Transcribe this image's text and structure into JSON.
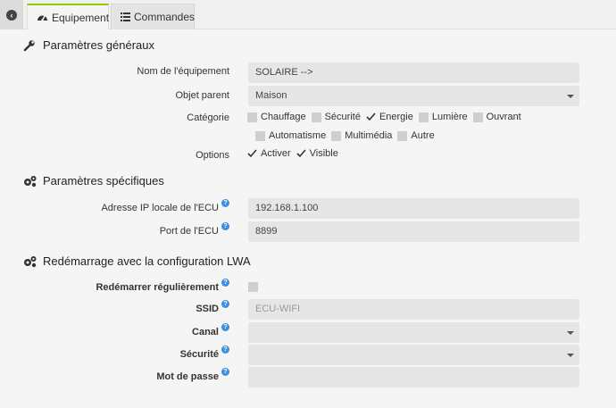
{
  "tabs": {
    "equipement": "Equipement",
    "commandes": "Commandes"
  },
  "general": {
    "title": "Paramètres généraux",
    "name_label": "Nom de l'équipement",
    "name_value": "SOLAIRE -->",
    "parent_label": "Objet parent",
    "parent_value": "Maison",
    "category_label": "Catégorie",
    "categories": [
      {
        "label": "Chauffage",
        "checked": false
      },
      {
        "label": "Sécurité",
        "checked": false
      },
      {
        "label": "Energie",
        "checked": true
      },
      {
        "label": "Lumière",
        "checked": false
      },
      {
        "label": "Ouvrant",
        "checked": false
      },
      {
        "label": "Automatisme",
        "checked": false
      },
      {
        "label": "Multimédia",
        "checked": false
      },
      {
        "label": "Autre",
        "checked": false
      }
    ],
    "options_label": "Options",
    "options": [
      {
        "label": "Activer",
        "checked": true
      },
      {
        "label": "Visible",
        "checked": true
      }
    ]
  },
  "specific": {
    "title": "Paramètres spécifiques",
    "ip_label": "Adresse IP locale de l'ECU",
    "ip_value": "192.168.1.100",
    "port_label": "Port de l'ECU",
    "port_value": "8899"
  },
  "reboot": {
    "title": "Redémarrage avec la configuration LWA",
    "restart_label": "Redémarrer régulièrement",
    "restart_checked": false,
    "ssid_label": "SSID",
    "ssid_placeholder": "ECU-WIFI",
    "canal_label": "Canal",
    "canal_value": "",
    "security_label": "Sécurité",
    "security_value": "",
    "password_label": "Mot de passe",
    "password_value": ""
  },
  "icons": {
    "back": "back-circle-icon",
    "equipement": "tachometer-icon",
    "commandes": "list-icon",
    "general": "wrench-icon",
    "specific": "cogs-icon",
    "reboot": "cogs-icon",
    "help": "question-circle-icon",
    "checkmark": "checkmark-icon"
  },
  "colors": {
    "accent": "#94ca02",
    "help": "#3d8fe0",
    "field_bg": "#e6e6e6"
  }
}
